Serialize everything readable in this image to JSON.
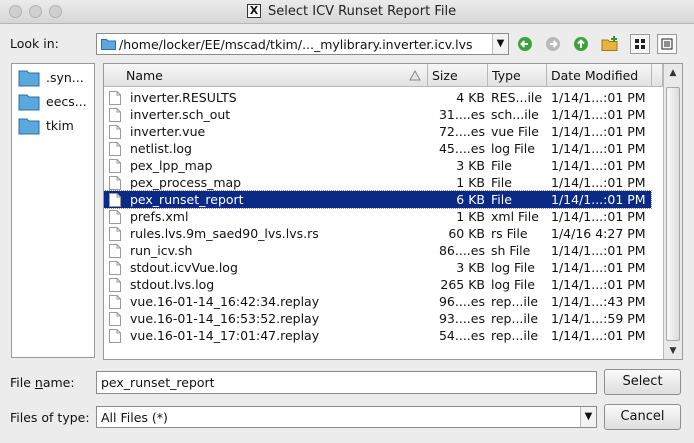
{
  "window": {
    "title": "Select ICV Runset Report File"
  },
  "look_in": {
    "label": "Look in:",
    "path": "/home/locker/EE/mscad/tkim/..._mylibrary.inverter.icv.lvs"
  },
  "toolbar": {
    "back_icon": "back-arrow-icon",
    "forward_icon": "forward-arrow-icon",
    "up_icon": "up-arrow-icon",
    "new_folder_icon": "new-folder-icon",
    "list_view_icon": "list-view-icon",
    "detail_view_icon": "detail-view-icon",
    "accent": "#2e9a2e"
  },
  "sidebar": {
    "items": [
      {
        "label": ".syn..."
      },
      {
        "label": "eecs..."
      },
      {
        "label": "tkim"
      }
    ]
  },
  "table": {
    "headers": {
      "name": "Name",
      "size": "Size",
      "type": "Type",
      "date": "Date Modified"
    },
    "rows": [
      {
        "name": "inverter.RESULTS",
        "size": "4 KB",
        "type": "RES...ile",
        "date": "1/14/1...:01 PM"
      },
      {
        "name": "inverter.sch_out",
        "size": "31....es",
        "type": "sch...ile",
        "date": "1/14/1...:01 PM"
      },
      {
        "name": "inverter.vue",
        "size": "72....es",
        "type": "vue File",
        "date": "1/14/1...:01 PM"
      },
      {
        "name": "netlist.log",
        "size": "45....es",
        "type": "log File",
        "date": "1/14/1...:01 PM"
      },
      {
        "name": "pex_lpp_map",
        "size": "3 KB",
        "type": "File",
        "date": "1/14/1...:01 PM"
      },
      {
        "name": "pex_process_map",
        "size": "1 KB",
        "type": "File",
        "date": "1/14/1...:01 PM"
      },
      {
        "name": "pex_runset_report",
        "size": "6 KB",
        "type": "File",
        "date": "1/14/1...:01 PM"
      },
      {
        "name": "prefs.xml",
        "size": "1 KB",
        "type": "xml File",
        "date": "1/14/1...:01 PM"
      },
      {
        "name": "rules.lvs.9m_saed90_lvs.lvs.rs",
        "size": "60 KB",
        "type": "rs File",
        "date": "1/4/16 4:27 PM"
      },
      {
        "name": "run_icv.sh",
        "size": "86....es",
        "type": "sh File",
        "date": "1/14/1...:01 PM"
      },
      {
        "name": "stdout.icvVue.log",
        "size": "3 KB",
        "type": "log File",
        "date": "1/14/1...:01 PM"
      },
      {
        "name": "stdout.lvs.log",
        "size": "265 KB",
        "type": "log File",
        "date": "1/14/1...:01 PM"
      },
      {
        "name": "vue.16-01-14_16:42:34.replay",
        "size": "96....es",
        "type": "rep...ile",
        "date": "1/14/1...:43 PM"
      },
      {
        "name": "vue.16-01-14_16:53:52.replay",
        "size": "93....es",
        "type": "rep...ile",
        "date": "1/14/1...:59 PM"
      },
      {
        "name": "vue.16-01-14_17:01:47.replay",
        "size": "54....es",
        "type": "rep...ile",
        "date": "1/14/1...:01 PM"
      }
    ],
    "selected_name": "pex_runset_report",
    "selection_color": "#0a2a86"
  },
  "file_name": {
    "label_prefix": "File ",
    "label_accel": "n",
    "label_suffix": "ame:",
    "value": "pex_runset_report"
  },
  "files_of_type": {
    "label": "Files of type:",
    "value": "All Files (*)"
  },
  "buttons": {
    "select": "Select",
    "cancel": "Cancel"
  }
}
